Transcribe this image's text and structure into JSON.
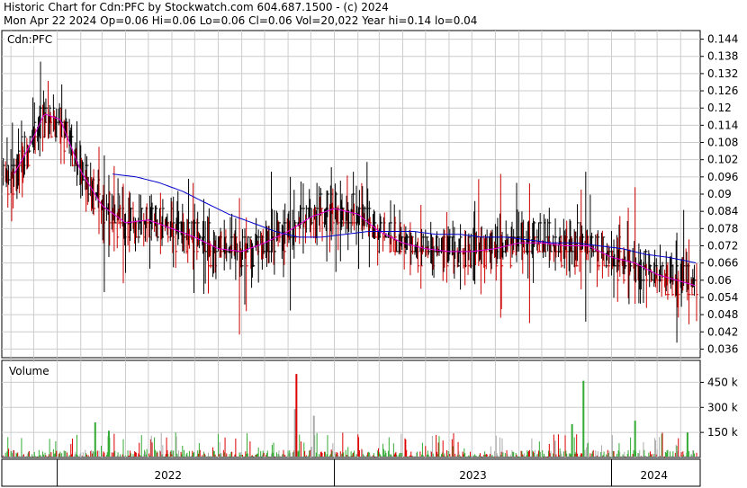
{
  "header": {
    "line1": "Historic Chart for Cdn:PFC by Stockwatch.com 604.687.1500 - (c) 2024",
    "line2": "Mon Apr 22 2024  Op=0.06  Hi=0.06  Lo=0.06  Cl=0.06  Vol=20,022  Year hi=0.14  lo=0.04"
  },
  "colors": {
    "ma_short": "#e000e0",
    "ma_long": "#0000cc",
    "price_up": "#000000",
    "price_down": "#cc0000",
    "vol_up": "#33aa33",
    "vol_down": "#dd0000",
    "vol_neutral": "#aaaaaa",
    "grid": "#cccccc"
  },
  "chart_data": [
    {
      "type": "ohlc",
      "title": "Cdn:PFC",
      "y_ticks": [
        "0.144",
        "0.138",
        "0.132",
        "0.126",
        "0.12",
        "0.114",
        "0.108",
        "0.102",
        "0.096",
        "0.09",
        "0.084",
        "0.078",
        "0.072",
        "0.066",
        "0.06",
        "0.054",
        "0.048",
        "0.042",
        "0.036"
      ],
      "ylim": [
        0.033,
        0.147
      ],
      "x_ticks": [
        "2022",
        "2023",
        "2024"
      ],
      "x_tick_dates": [
        "2022-01-01",
        "2023-01-01",
        "2024-01-01"
      ],
      "x_range": [
        "2021-10-20",
        "2024-04-22"
      ],
      "grid": true,
      "series": [
        {
          "style": "ma_short",
          "x": [
            "2021-11-05",
            "2021-11-20",
            "2021-12-01",
            "2021-12-15",
            "2022-01-05",
            "2022-02-01",
            "2022-03-01",
            "2022-04-01",
            "2022-05-01",
            "2022-06-01",
            "2022-07-01",
            "2022-08-01",
            "2022-09-01",
            "2022-10-01",
            "2022-11-01",
            "2022-12-01",
            "2023-01-01",
            "2023-02-01",
            "2023-03-01",
            "2023-04-01",
            "2023-05-01",
            "2023-06-01",
            "2023-07-01",
            "2023-08-01",
            "2023-09-01",
            "2023-10-01",
            "2023-11-01",
            "2023-12-01",
            "2024-01-01",
            "2024-02-01",
            "2024-03-01",
            "2024-04-22"
          ],
          "y": [
            0.097,
            0.104,
            0.11,
            0.118,
            0.116,
            0.098,
            0.086,
            0.08,
            0.081,
            0.078,
            0.075,
            0.071,
            0.07,
            0.073,
            0.077,
            0.082,
            0.085,
            0.083,
            0.077,
            0.073,
            0.071,
            0.07,
            0.07,
            0.071,
            0.073,
            0.073,
            0.072,
            0.072,
            0.068,
            0.066,
            0.062,
            0.058
          ]
        },
        {
          "style": "ma_long",
          "x": [
            "2022-03-15",
            "2022-04-15",
            "2022-05-15",
            "2022-06-15",
            "2022-07-15",
            "2022-08-15",
            "2022-09-15",
            "2022-10-15",
            "2022-11-15",
            "2022-12-15",
            "2023-01-15",
            "2023-02-15",
            "2023-03-15",
            "2023-04-15",
            "2023-05-15",
            "2023-06-15",
            "2023-07-15",
            "2023-08-15",
            "2023-09-15",
            "2023-10-15",
            "2023-11-15",
            "2023-12-15",
            "2024-01-15",
            "2024-02-15",
            "2024-03-15",
            "2024-04-22"
          ],
          "y": [
            0.097,
            0.096,
            0.094,
            0.091,
            0.087,
            0.083,
            0.08,
            0.077,
            0.075,
            0.075,
            0.076,
            0.077,
            0.077,
            0.077,
            0.076,
            0.076,
            0.075,
            0.075,
            0.074,
            0.073,
            0.073,
            0.072,
            0.071,
            0.069,
            0.068,
            0.066
          ]
        }
      ]
    },
    {
      "type": "bar",
      "title": "Volume",
      "y_ticks": [
        "450 k",
        "300 k",
        "150 k"
      ],
      "y_tick_values": [
        450000,
        300000,
        150000
      ],
      "ylim": [
        0,
        560000
      ],
      "x_range": [
        "2021-10-20",
        "2024-04-22"
      ],
      "grid": true,
      "highlights": [
        {
          "x": "2022-02-20",
          "value": 210000,
          "color": "vol_up"
        },
        {
          "x": "2022-03-10",
          "value": 160000,
          "color": "vol_up"
        },
        {
          "x": "2022-11-10",
          "value": 290000,
          "color": "vol_neutral"
        },
        {
          "x": "2022-11-12",
          "value": 500000,
          "color": "vol_down"
        },
        {
          "x": "2022-12-05",
          "value": 250000,
          "color": "vol_neutral"
        },
        {
          "x": "2023-11-25",
          "value": 460000,
          "color": "vol_up"
        },
        {
          "x": "2023-11-10",
          "value": 200000,
          "color": "vol_up"
        },
        {
          "x": "2024-02-01",
          "value": 220000,
          "color": "vol_up"
        },
        {
          "x": "2024-04-10",
          "value": 150000,
          "color": "vol_up"
        }
      ]
    }
  ]
}
